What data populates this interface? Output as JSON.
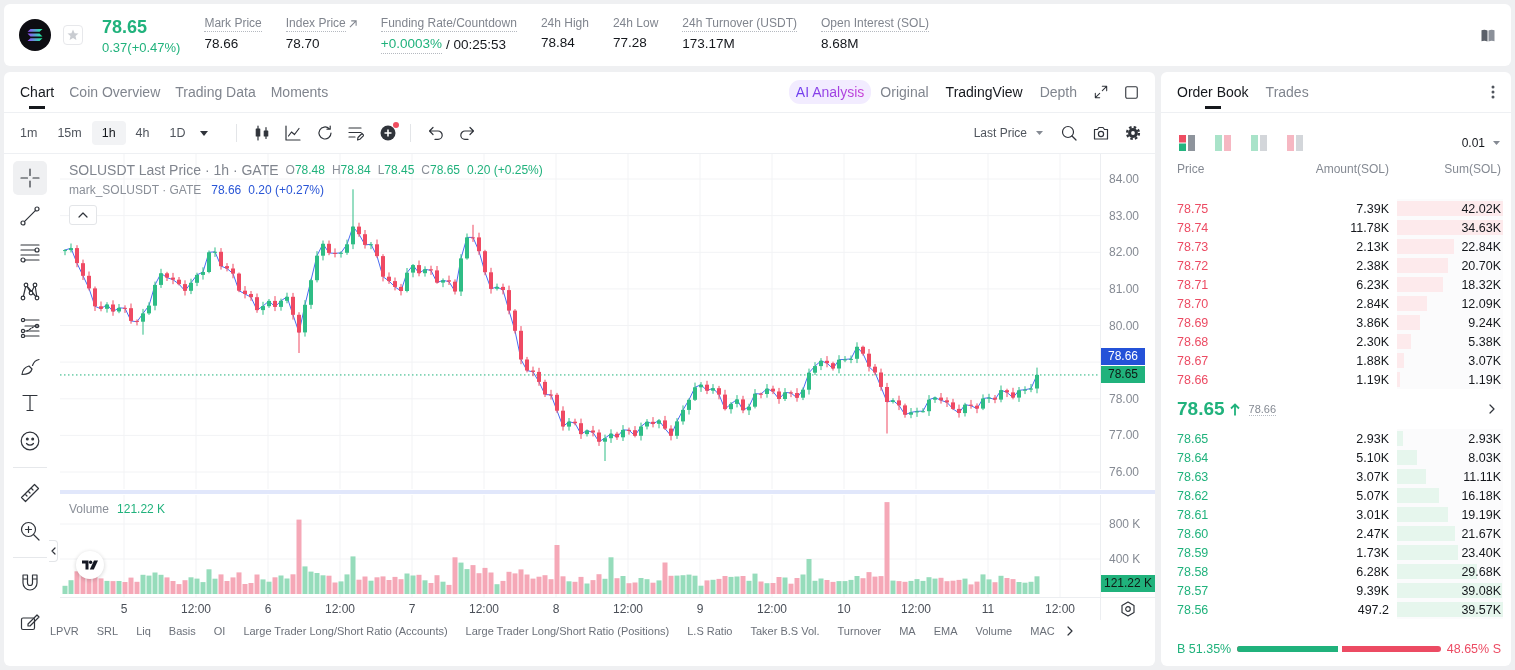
{
  "header": {
    "price": "78.65",
    "change": "0.37(+0.47%)",
    "rising": true,
    "starred": false,
    "stats": [
      {
        "label": "Mark Price",
        "value": "78.66",
        "dotted": true
      },
      {
        "label": "Index Price",
        "value": "78.70",
        "dotted": true,
        "external": true
      },
      {
        "label": "Funding Rate/Countdown",
        "value": "+0.0003%",
        "value_dotted": true,
        "rising": true,
        "extra": "/ 00:25:53",
        "dotted": true
      },
      {
        "label": "24h High",
        "value": "78.84",
        "dotted": false
      },
      {
        "label": "24h Low",
        "value": "77.28",
        "dotted": false
      },
      {
        "label": "24h Turnover (USDT)",
        "value": "173.17M",
        "dotted": true
      },
      {
        "label": "Open Interest (SOL)",
        "value": "8.68M",
        "dotted": true
      }
    ]
  },
  "chart": {
    "tabs": [
      {
        "label": "Chart",
        "selected": true
      },
      {
        "label": "Coin Overview",
        "selected": false
      },
      {
        "label": "Trading Data",
        "selected": false
      },
      {
        "label": "Moments",
        "selected": false
      }
    ],
    "views": [
      {
        "label": "AI Analysis",
        "kind": "ai",
        "selected": false
      },
      {
        "label": "Original",
        "kind": "plain",
        "selected": false
      },
      {
        "label": "TradingView",
        "kind": "plain",
        "selected": true
      },
      {
        "label": "Depth",
        "kind": "plain",
        "selected": false
      }
    ],
    "intervals": [
      {
        "label": "1m",
        "selected": false
      },
      {
        "label": "15m",
        "selected": false
      },
      {
        "label": "1h",
        "selected": true
      },
      {
        "label": "4h",
        "selected": false
      },
      {
        "label": "1D",
        "selected": false
      }
    ],
    "new_badge": true,
    "price_source": "Last Price",
    "tools": [
      {
        "kind": "crosshair",
        "selected": true
      },
      {
        "kind": "line",
        "selected": false
      },
      {
        "kind": "levels",
        "selected": false
      },
      {
        "kind": "pattern",
        "selected": false
      },
      {
        "kind": "fib",
        "selected": false
      },
      {
        "kind": "brush",
        "selected": false
      },
      {
        "kind": "text",
        "selected": false
      },
      {
        "kind": "emoji",
        "selected": false
      },
      {
        "kind": "ruler",
        "selected": false
      },
      {
        "kind": "zoom",
        "selected": false
      },
      {
        "kind": "magnet",
        "selected": false
      },
      {
        "kind": "pencil",
        "selected": false
      }
    ],
    "legend": {
      "title": "SOLUSDT Last Price · 1h · GATE",
      "rising": true,
      "ohlc": [
        {
          "key": "O",
          "value": "78.48"
        },
        {
          "key": "H",
          "value": "78.84"
        },
        {
          "key": "L",
          "value": "78.45"
        },
        {
          "key": "C",
          "value": "78.65"
        }
      ],
      "change": "0.20 (+0.25%)"
    },
    "mark_legend": {
      "title": "mark_SOLUSDT · GATE",
      "price": "78.66",
      "change": "0.20 (+0.27%)"
    },
    "price_axis": [
      "84.00",
      "83.00",
      "82.00",
      "81.00",
      "80.00",
      "78.00",
      "77.00",
      "76.00"
    ],
    "price_tags": [
      {
        "kind": "mark",
        "value": "78.66"
      },
      {
        "kind": "last",
        "value": "78.65"
      }
    ],
    "volume": {
      "label": "Volume",
      "value": "121.22 K",
      "axis": [
        "800 K",
        "400 K"
      ],
      "tag": "121.22 K"
    },
    "time_axis": [
      "5",
      "12:00",
      "6",
      "12:00",
      "7",
      "12:00",
      "8",
      "12:00",
      "9",
      "12:00",
      "10",
      "12:00",
      "11",
      "12:00"
    ],
    "indicators": [
      "LPVR",
      "SRL",
      "Liq",
      "Basis",
      "OI",
      "Large Trader Long/Short Ratio (Accounts)",
      "Large Trader Long/Short Ratio (Positions)",
      "L.S Ratio",
      "Taker B.S Vol.",
      "Turnover",
      "MA",
      "EMA",
      "Volume",
      "MAC"
    ]
  },
  "order_book": {
    "tabs": [
      {
        "label": "Order Book",
        "selected": true
      },
      {
        "label": "Trades",
        "selected": false
      }
    ],
    "layouts": [
      {
        "kind": "both",
        "selected": true
      },
      {
        "kind": "split",
        "selected": false
      },
      {
        "kind": "bids",
        "selected": false
      },
      {
        "kind": "asks",
        "selected": false
      }
    ],
    "precision": "0.01",
    "columns": [
      "Price",
      "Amount(SOL)",
      "Sum(SOL)"
    ],
    "asks": [
      {
        "price": "78.75",
        "amount": "7.39K",
        "sum": "42.02K",
        "level": 1.0
      },
      {
        "price": "78.74",
        "amount": "11.78K",
        "sum": "34.63K",
        "level": 1.0
      },
      {
        "price": "78.73",
        "amount": "2.13K",
        "sum": "22.84K",
        "level": 0.54
      },
      {
        "price": "78.72",
        "amount": "2.38K",
        "sum": "20.70K",
        "level": 0.48
      },
      {
        "price": "78.71",
        "amount": "6.23K",
        "sum": "18.32K",
        "level": 0.43
      },
      {
        "price": "78.70",
        "amount": "2.84K",
        "sum": "12.09K",
        "level": 0.28
      },
      {
        "price": "78.69",
        "amount": "3.86K",
        "sum": "9.24K",
        "level": 0.22
      },
      {
        "price": "78.68",
        "amount": "2.30K",
        "sum": "5.38K",
        "level": 0.13
      },
      {
        "price": "78.67",
        "amount": "1.88K",
        "sum": "3.07K",
        "level": 0.07
      },
      {
        "price": "78.66",
        "amount": "1.19K",
        "sum": "1.19K",
        "level": 0.03
      }
    ],
    "mid": {
      "price": "78.65",
      "rising": true,
      "mark": "78.66"
    },
    "bids": [
      {
        "price": "78.65",
        "amount": "2.93K",
        "sum": "2.93K",
        "level": 0.06
      },
      {
        "price": "78.64",
        "amount": "5.10K",
        "sum": "8.03K",
        "level": 0.19
      },
      {
        "price": "78.63",
        "amount": "3.07K",
        "sum": "11.11K",
        "level": 0.27
      },
      {
        "price": "78.62",
        "amount": "5.07K",
        "sum": "16.18K",
        "level": 0.4
      },
      {
        "price": "78.61",
        "amount": "3.01K",
        "sum": "19.19K",
        "level": 0.48
      },
      {
        "price": "78.60",
        "amount": "2.47K",
        "sum": "21.67K",
        "level": 0.55
      },
      {
        "price": "78.59",
        "amount": "1.73K",
        "sum": "23.40K",
        "level": 0.58
      },
      {
        "price": "78.58",
        "amount": "6.28K",
        "sum": "29.68K",
        "level": 0.75
      },
      {
        "price": "78.57",
        "amount": "9.39K",
        "sum": "39.08K",
        "level": 0.99
      },
      {
        "price": "78.56",
        "amount": "497.2",
        "sum": "39.57K",
        "level": 1.0
      }
    ],
    "ratio": {
      "buy": "B 51.35%",
      "sell": "48.65% S",
      "level": 0.5135
    }
  }
}
